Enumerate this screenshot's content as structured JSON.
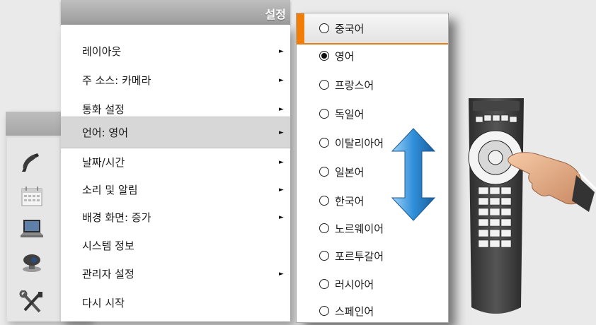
{
  "settings_menu": {
    "title": "설정",
    "items": [
      {
        "label": "레이아웃",
        "has_submenu": true
      },
      {
        "label": "주 소스: 카메라",
        "has_submenu": true
      },
      {
        "label": "통화 설정",
        "has_submenu": true
      },
      {
        "label": "언어: 영어",
        "has_submenu": true,
        "selected": true
      },
      {
        "label": "날짜/시간",
        "has_submenu": true
      },
      {
        "label": "소리 및 알림",
        "has_submenu": true
      },
      {
        "label": "배경 화면: 증가",
        "has_submenu": true
      },
      {
        "label": "시스템 정보",
        "has_submenu": false
      },
      {
        "label": "관리자 설정",
        "has_submenu": true
      },
      {
        "label": "다시 시작",
        "has_submenu": false
      }
    ],
    "arrow_glyph": "►"
  },
  "language_menu": {
    "items": [
      {
        "label": "중국어",
        "checked": false,
        "highlighted": true
      },
      {
        "label": "영어",
        "checked": true
      },
      {
        "label": "프랑스어",
        "checked": false
      },
      {
        "label": "독일어",
        "checked": false
      },
      {
        "label": "이탈리아어",
        "checked": false
      },
      {
        "label": "일본어",
        "checked": false
      },
      {
        "label": "한국어",
        "checked": false
      },
      {
        "label": "노르웨이어",
        "checked": false
      },
      {
        "label": "포르투갈어",
        "checked": false
      },
      {
        "label": "러시아어",
        "checked": false
      },
      {
        "label": "스페인어",
        "checked": false
      }
    ]
  },
  "side_icons": [
    "phone-icon",
    "calendar-icon",
    "laptop-icon",
    "camera-icon",
    "tools-icon"
  ],
  "colors": {
    "accent": "#f07d05",
    "arrow_blue": "#2f8fd8",
    "menu_header": "#a8a8a8"
  }
}
